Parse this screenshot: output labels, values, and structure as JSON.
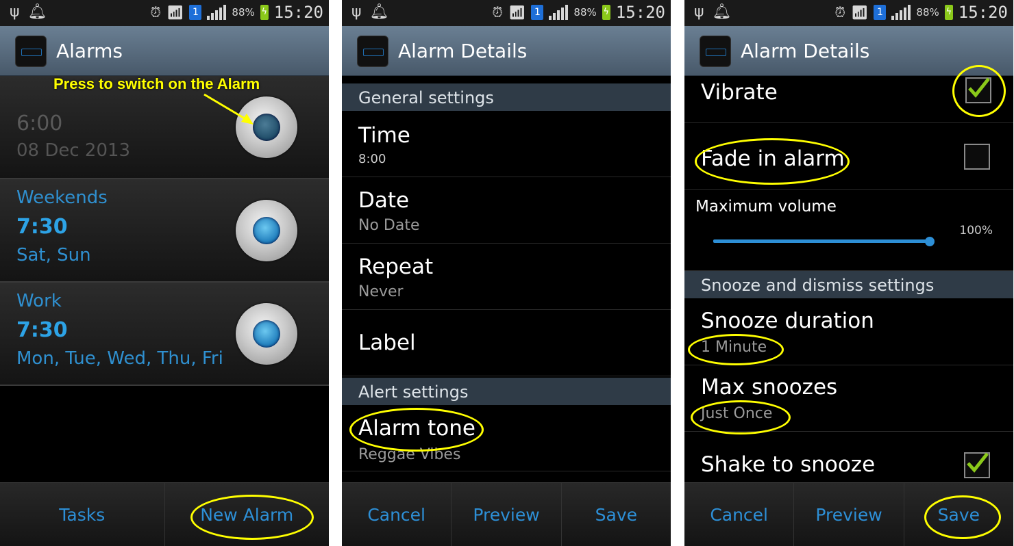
{
  "status_bar": {
    "battery": "88%",
    "time": "15:20",
    "sim": "1"
  },
  "screen1": {
    "title": "Alarms",
    "annotation": "Press to switch on the Alarm",
    "alarms": [
      {
        "name": "",
        "time": "6:00",
        "days": "08 Dec 2013",
        "enabled": false
      },
      {
        "name": "Weekends",
        "time": "7:30",
        "days": "Sat, Sun",
        "enabled": true
      },
      {
        "name": "Work",
        "time": "7:30",
        "days": "Mon, Tue, Wed, Thu, Fri",
        "enabled": true
      }
    ],
    "buttons": {
      "tasks": "Tasks",
      "new_alarm": "New Alarm"
    }
  },
  "screen2": {
    "title": "Alarm Details",
    "general_header": "General settings",
    "time_label": "Time",
    "time_value": "8:00",
    "date_label": "Date",
    "date_value": "No Date",
    "repeat_label": "Repeat",
    "repeat_value": "Never",
    "label_label": "Label",
    "alert_header": "Alert settings",
    "tone_label": "Alarm tone",
    "tone_value": "Reggae Vibes",
    "buttons": {
      "cancel": "Cancel",
      "preview": "Preview",
      "save": "Save"
    }
  },
  "screen3": {
    "title": "Alarm Details",
    "vibrate_label": "Vibrate",
    "vibrate_checked": true,
    "fade_label": "Fade in alarm",
    "fade_checked": false,
    "volume_label": "Maximum volume",
    "volume_value": "100%",
    "volume_level": 1.0,
    "snooze_header": "Snooze and dismiss settings",
    "snooze_duration_label": "Snooze duration",
    "snooze_duration_value": "1 Minute",
    "max_snoozes_label": "Max snoozes",
    "max_snoozes_value": "Just Once",
    "shake_label": "Shake to snooze",
    "shake_checked": true,
    "buttons": {
      "cancel": "Cancel",
      "preview": "Preview",
      "save": "Save"
    }
  },
  "colors": {
    "accent": "#2d8fd6",
    "highlight": "#ffff00",
    "check": "#8bc91a"
  }
}
